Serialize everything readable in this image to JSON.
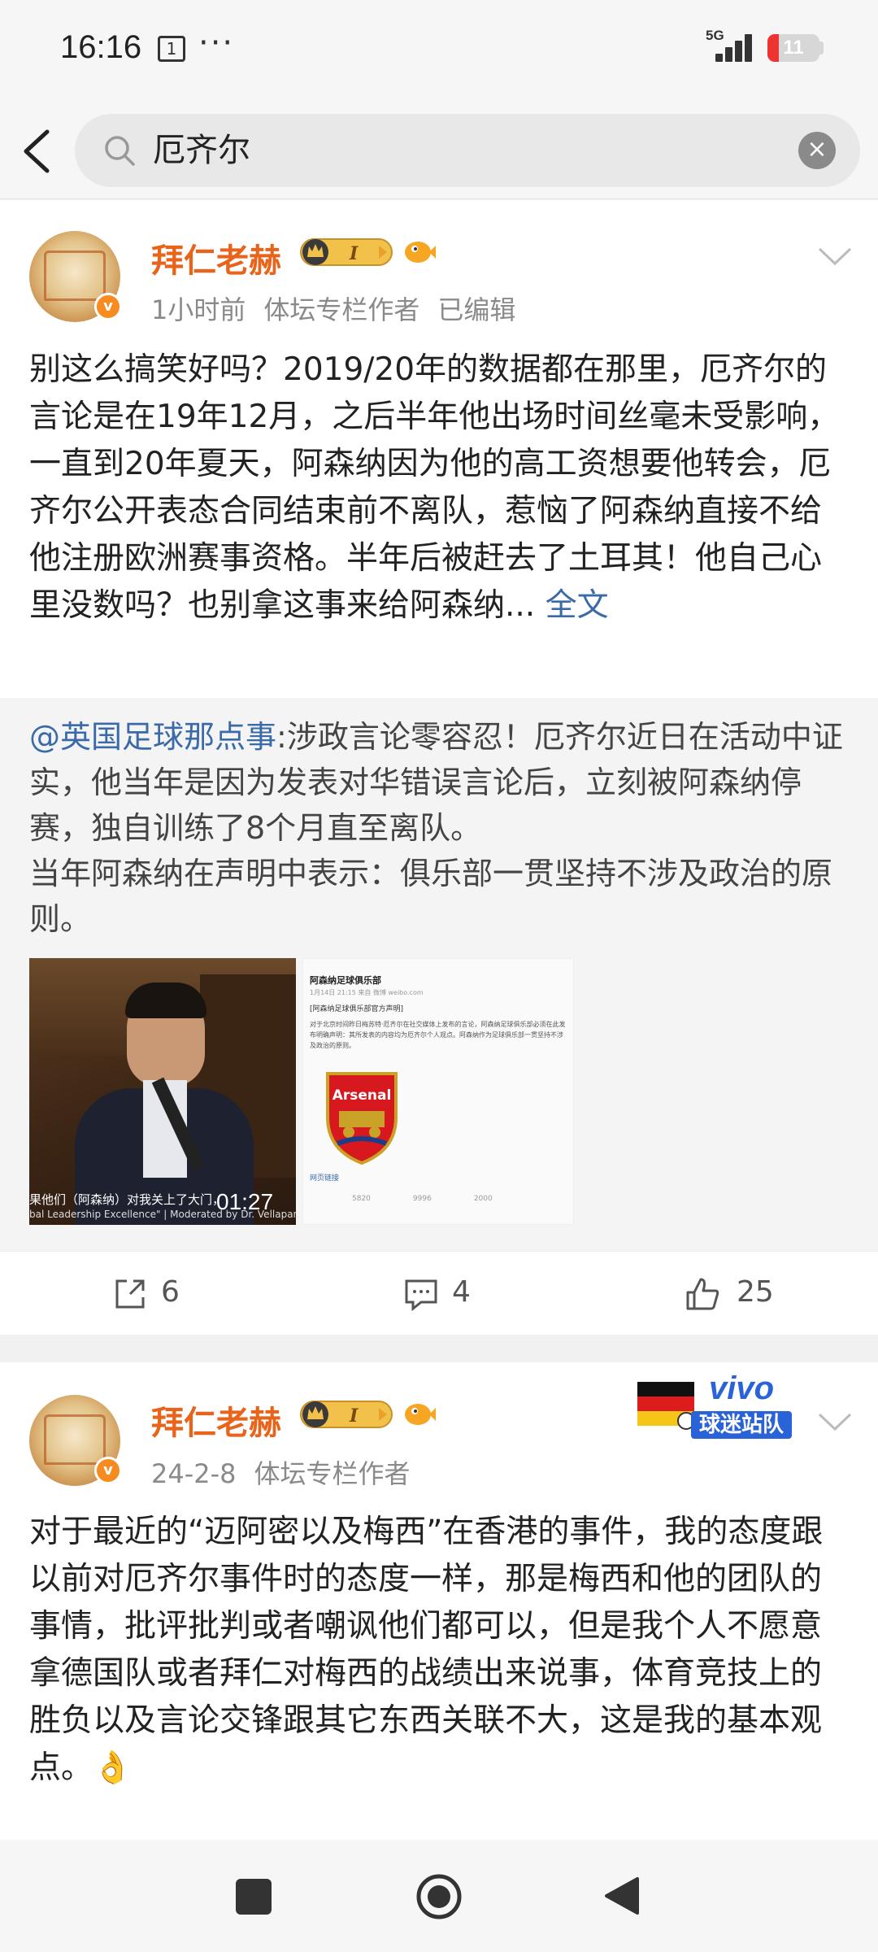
{
  "status": {
    "time": "16:16",
    "notif_icon_text": "1",
    "more": "···",
    "network": "5G",
    "battery": "11"
  },
  "search": {
    "query": "厄齐尔"
  },
  "posts": [
    {
      "username": "拜仁老赫",
      "level_badge": "I",
      "meta": [
        "1小时前",
        "体坛专栏作者",
        "已编辑"
      ],
      "text": "别这么搞笑好吗？2019/20年的数据都在那里，厄齐尔的言论是在19年12月，之后半年他出场时间丝毫未受影响，一直到20年夏天，阿森纳因为他的高工资想要他转会，厄齐尔公开表态合同结束前不离队，惹恼了阿森纳直接不给他注册欧洲赛事资格。半年后被赶去了土耳其！他自己心里没数吗？也别拿这事来给阿森纳...",
      "full_text_link": "全文",
      "repost": {
        "mention": "@英国足球那点事",
        "text": ":涉政言论零容忍！厄齐尔近日在活动中证实，他当年是因为发表对华错误言论后，立刻被阿森纳停赛，独自训练了8个月直至离队。",
        "text2": "当年阿森纳在声明中表示：俱乐部一贯坚持不涉及政治的原则。",
        "video": {
          "caption": "果他们（阿森纳）对我关上了大门，",
          "caption2": "bal Leadership Excellence\" | Moderated by Dr. Vellapandi",
          "duration": "01:27"
        },
        "screenshot": {
          "header": "阿森纳足球俱乐部",
          "sub": "1月14日 21:15 来自 微博 weibo.com",
          "title": "[阿森纳足球俱乐部官方声明]",
          "body": "对于北京时间昨日梅苏特·厄齐尔在社交媒体上发布的言论，阿森纳足球俱乐部必须在此发布明确声明：其所发表的内容均为厄齐尔个人观点。阿森纳作为足球俱乐部一贯坚持不涉及政治的原则。",
          "crest_text": "Arsenal",
          "link": "网页链接",
          "stats": [
            "5820",
            "9996",
            "2000"
          ]
        }
      },
      "actions": {
        "repost": "6",
        "comment": "4",
        "like": "25"
      }
    },
    {
      "username": "拜仁老赫",
      "level_badge": "I",
      "meta": [
        "24-2-8",
        "体坛专栏作者"
      ],
      "fan_badge": {
        "brand": "vivo",
        "label": "球迷站队"
      },
      "text": "对于最近的“迈阿密以及梅西”在香港的事件，我的态度跟以前对厄齐尔事件时的态度一样，那是梅西和他的团队的事情，批评批判或者嘲讽他们都可以，但是我个人不愿意拿德国队或者拜仁对梅西的战绩出来说事，体育竞技上的胜负以及言论交锋跟其它东西关联不大，这是我的基本观点。",
      "emoji": "👌"
    }
  ],
  "nav": [
    "recent-apps",
    "home",
    "back"
  ],
  "colors": {
    "accent_orange": "#e8641a",
    "link_blue": "#3a6aa8",
    "battery_red": "#e33333"
  }
}
